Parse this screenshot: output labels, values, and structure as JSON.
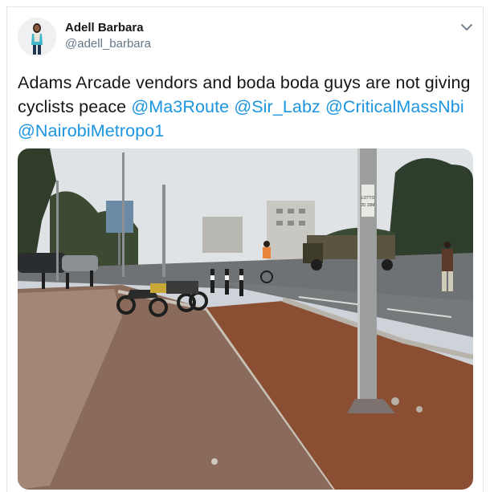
{
  "tweet": {
    "author_name": "Adell Barbara",
    "author_handle": "@adell_barbara",
    "text_before": "Adams Arcade vendors and boda boda guys are not giving cyclists peace ",
    "mentions": [
      "@Ma3Route",
      "@Sir_Labz",
      "@CriticalMassNbi",
      "@NairobiMetropo1"
    ]
  },
  "icons": {
    "menu": "chevron-down-icon"
  },
  "photo": {
    "pole_sign_text": [
      "LOTTO",
      "20 15M"
    ],
    "colors": {
      "sky": "#dfe3e6",
      "road": "#6f7275",
      "footpath": "#8a6a5a",
      "soil": "#8a4e33",
      "truck": "#3e3a2a"
    }
  },
  "colors": {
    "mention": "#1b95e0",
    "text": "#14171a",
    "secondary": "#657786",
    "border": "#e1e8ed"
  }
}
